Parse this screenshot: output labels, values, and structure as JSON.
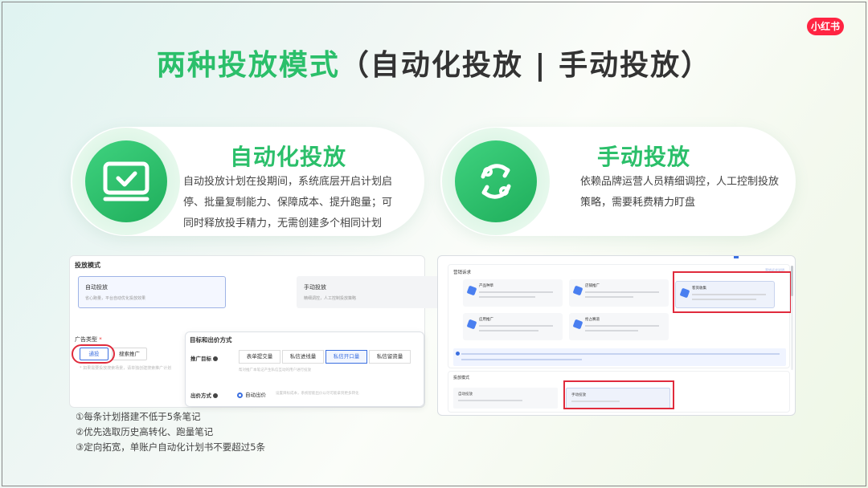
{
  "logo": {
    "text": "小红书"
  },
  "title": {
    "green": "两种投放模式",
    "dark": "（自动化投放 | 手动投放）"
  },
  "auto_card": {
    "title": "自动化投放",
    "description": "自动投放计划在投期间，系统底层开启计划启停、批量复制能力、保障成本、提升跑量；可同时释放投手精力，无需创建多个相同计划",
    "icon": "monitor-check-icon"
  },
  "manual_card": {
    "title": "手动投放",
    "description": "依赖品牌运营人员精细调控，人工控制投放策略，需要耗费精力盯盘",
    "icon": "manual-cycle-icon"
  },
  "left_screenshot": {
    "heading": "投放模式",
    "auto_option": {
      "title": "自动投放",
      "desc": "省心跑量，平台自动优化投放效果"
    },
    "manual_option": {
      "title": "手动投放",
      "desc": "精细调控，人工控制投放策略"
    },
    "ad_type_label": "广告类型",
    "ad_type_required": "*",
    "ad_types": [
      "通投",
      "搜索推广"
    ],
    "ad_type_hint": "* 如果需要投放搜索场景，请单独创建搜索推广计划"
  },
  "goal_panel": {
    "title": "目标和出价方式",
    "goal_label": "推广目标",
    "goals": [
      "表单提交量",
      "私信进线量",
      "私信开口量",
      "私信留资量"
    ],
    "goals_selected_index": 2,
    "goal_hint": "帮对推广本笔记产生私信互动的用户进行投放",
    "bid_label": "出价方式",
    "bid_option": "自动出价",
    "bid_desc": "设置目标成本，系统智能出价以尽可能拿到更多转化"
  },
  "notes": [
    "①每条计划搭建不低于5条笔记",
    "②优先选取历史高转化、跑量笔记",
    "③定向拓宽，单账户自动化计划书不要超过5条"
  ],
  "right_screenshot": {
    "heading": "营销诉求",
    "link": "营销诉求说明",
    "tiles": [
      {
        "title": "产品种草"
      },
      {
        "title": "店铺推广"
      },
      {
        "title": "客资收集"
      },
      {
        "title": "应用推广"
      },
      {
        "title": "抢占赛道"
      }
    ],
    "lower_heading": "投放模式",
    "lower_cards": [
      {
        "title": "自动投放"
      },
      {
        "title": "手动投放"
      }
    ]
  },
  "colors": {
    "brand_green": "#2bbf6a",
    "highlight_red": "#e02b3c",
    "ui_blue": "#3b6fe0",
    "logo_red": "#ff2442"
  }
}
